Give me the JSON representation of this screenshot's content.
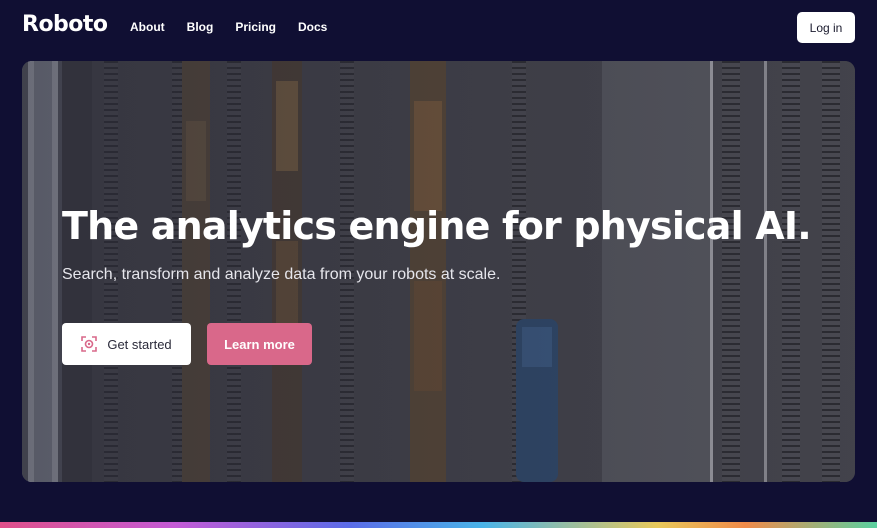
{
  "nav": {
    "logo_text": "Roboto",
    "links": [
      "About",
      "Blog",
      "Pricing",
      "Docs"
    ],
    "login_label": "Log in"
  },
  "hero": {
    "title": "The analytics engine for physical AI.",
    "subtitle": "Search, transform and analyze data from your robots at scale.",
    "primary_button": "Get started",
    "secondary_button": "Learn more",
    "background_image": "aerial view of railway tracks with freight trains"
  },
  "colors": {
    "page_background": "#100f33",
    "accent": "#d9688a",
    "button_light": "#ffffff"
  },
  "icons": {
    "primary_button_icon": "robot-scan-icon"
  }
}
